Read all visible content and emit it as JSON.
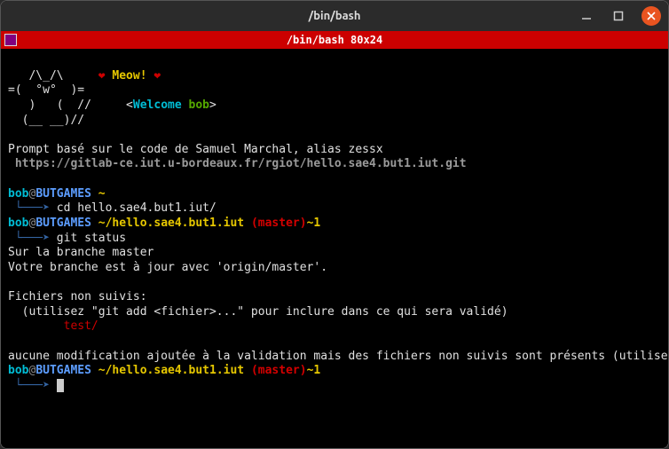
{
  "window": {
    "title": "/bin/bash"
  },
  "tab": {
    "title": "/bin/bash 80x24"
  },
  "ascii": {
    "l1": "   /\\_/\\     ",
    "l1m": "Meow! ",
    "l2": "=(  °w°  )=",
    "l3": "   )   (  //     <",
    "l3w": "Welcome ",
    "l3u": "bob",
    "l3e": ">",
    "l4": "  (__ __)//"
  },
  "motd": {
    "line1": "Prompt basé sur le code de Samuel Marchal, alias zessx",
    "line2": " https://gitlab-ce.iut.u-bordeaux.fr/rgiot/hello.sae4.but1.iut.git"
  },
  "prompt": {
    "user": "bob",
    "at": "@",
    "host": "BUTGAMES",
    "home": " ~",
    "dir": " ~/hello.sae4.but1.iut",
    "branch": " (master)",
    "mod": "~1",
    "arrow_prefix": " └───",
    "arrow": "➤ "
  },
  "cmd": {
    "cd": "cd hello.sae4.but1.iut/",
    "status": "git status"
  },
  "out": {
    "branch": "Sur la branche master",
    "uptodate": "Votre branche est à jour avec 'origin/master'.",
    "untracked_h": "Fichiers non suivis:",
    "untracked_hint": "  (utilisez \"git add <fichier>...\" pour inclure dans ce qui sera validé)",
    "untracked_file": "        test/",
    "footer": "aucune modification ajoutée à la validation mais des fichiers non suivis sont présents (utilisez \"git add\" pour les suivre)"
  }
}
